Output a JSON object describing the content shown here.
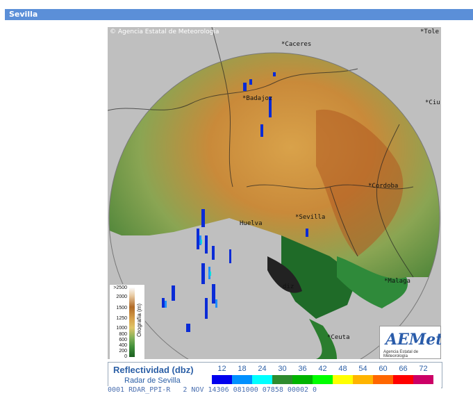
{
  "header": {
    "title": "Sevilla"
  },
  "map": {
    "copyright": "Agencia Estatal de Meteorologia",
    "cities": [
      "Caceres",
      "Badajoz",
      "Sevilla",
      "Huelva",
      "Cordoba",
      "Malaga",
      "Ceuta",
      "Toledo",
      "Ciudad Real",
      "Cadiz"
    ],
    "city_labels": [
      "*Caceres",
      "*Badajoz",
      "*Sevilla",
      "Huelva",
      "*Cordoba",
      "*Malaga",
      "*Ceuta",
      "*Tole",
      "*Ciu",
      "diz"
    ]
  },
  "orography": {
    "title": "Orografía (m)",
    "ticks": [
      ">2500",
      "2000",
      "1500",
      "1250",
      "1000",
      "800",
      "600",
      "400",
      "200",
      "0"
    ]
  },
  "logo": {
    "name": "AEMet",
    "subtitle": "Agencia Estatal de Meteorología"
  },
  "reflectivity": {
    "title": "Reflectividad (dbz)",
    "subtitle": "Radar de Sevilla",
    "scale": [
      {
        "value": "12",
        "color": "#0000ee"
      },
      {
        "value": "18",
        "color": "#0090ff"
      },
      {
        "value": "24",
        "color": "#00ffff"
      },
      {
        "value": "30",
        "color": "#2e8b2e"
      },
      {
        "value": "36",
        "color": "#00b400"
      },
      {
        "value": "42",
        "color": "#00ff00"
      },
      {
        "value": "48",
        "color": "#ffff00"
      },
      {
        "value": "54",
        "color": "#ffb400"
      },
      {
        "value": "60",
        "color": "#ff6600"
      },
      {
        "value": "66",
        "color": "#ff0000"
      },
      {
        "value": "72",
        "color": "#cc0066"
      }
    ]
  },
  "status": {
    "text": "0001 RDAR_PPI-R   2 NOV 14306 081000 07858 00002 0"
  }
}
